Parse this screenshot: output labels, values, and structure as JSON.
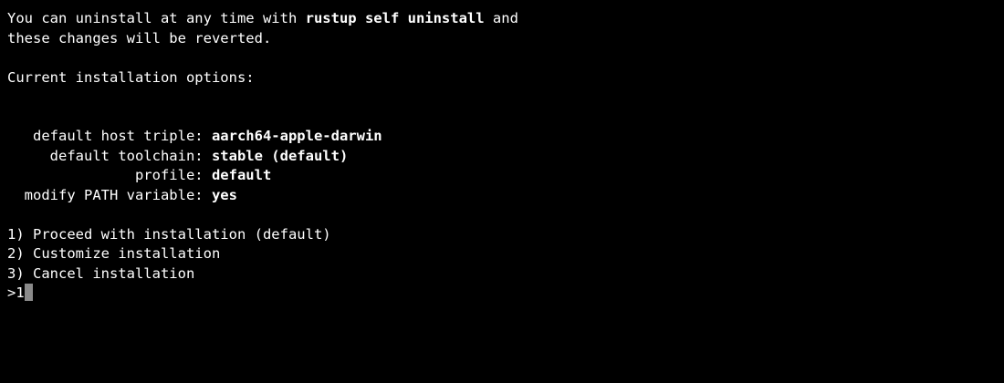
{
  "intro": {
    "line1_prefix": "You can uninstall at any time with ",
    "line1_command": "rustup self uninstall",
    "line1_suffix": " and",
    "line2": "these changes will be reverted."
  },
  "options_heading": "Current installation options:",
  "options": [
    {
      "label": "   default host triple: ",
      "value": "aarch64-apple-darwin"
    },
    {
      "label": "     default toolchain: ",
      "value": "stable (default)"
    },
    {
      "label": "               profile: ",
      "value": "default"
    },
    {
      "label": "  modify PATH variable: ",
      "value": "yes"
    }
  ],
  "menu": [
    "1) Proceed with installation (default)",
    "2) Customize installation",
    "3) Cancel installation"
  ],
  "prompt": {
    "symbol": ">",
    "input": "1"
  }
}
